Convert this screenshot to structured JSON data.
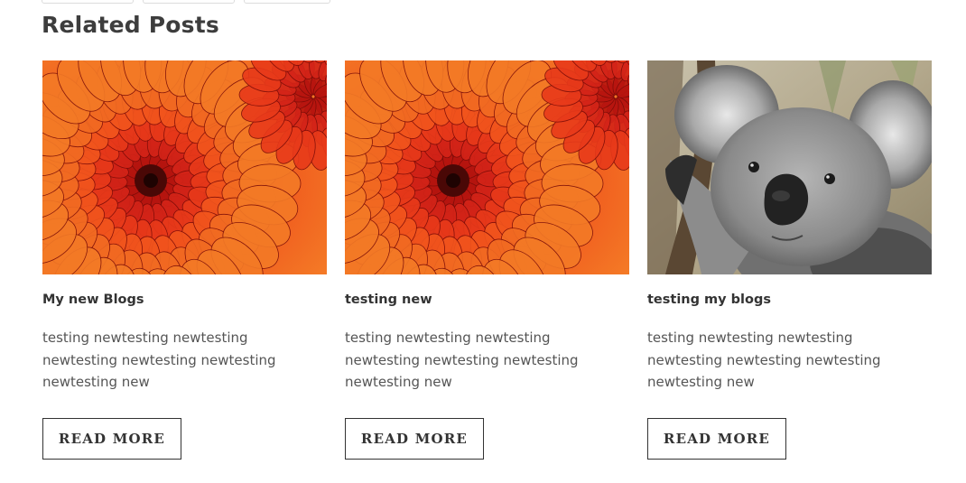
{
  "section": {
    "title": "Related Posts"
  },
  "posts": [
    {
      "title": "My new Blogs",
      "excerpt": "testing newtesting newtesting newtesting newtesting newtesting newtesting new",
      "image": "chrysanthemum-photo",
      "button": "READ MORE"
    },
    {
      "title": "testing new",
      "excerpt": "testing newtesting newtesting newtesting newtesting newtesting newtesting new",
      "image": "chrysanthemum-photo",
      "button": "READ MORE"
    },
    {
      "title": "testing my blogs",
      "excerpt": "testing newtesting newtesting newtesting newtesting newtesting newtesting new",
      "image": "koala-photo",
      "button": "READ MORE"
    }
  ],
  "colors": {
    "flower_red": "#d9261c",
    "flower_orange": "#f06a1c",
    "koala_gray": "#8e8e8e",
    "text": "#333333"
  }
}
